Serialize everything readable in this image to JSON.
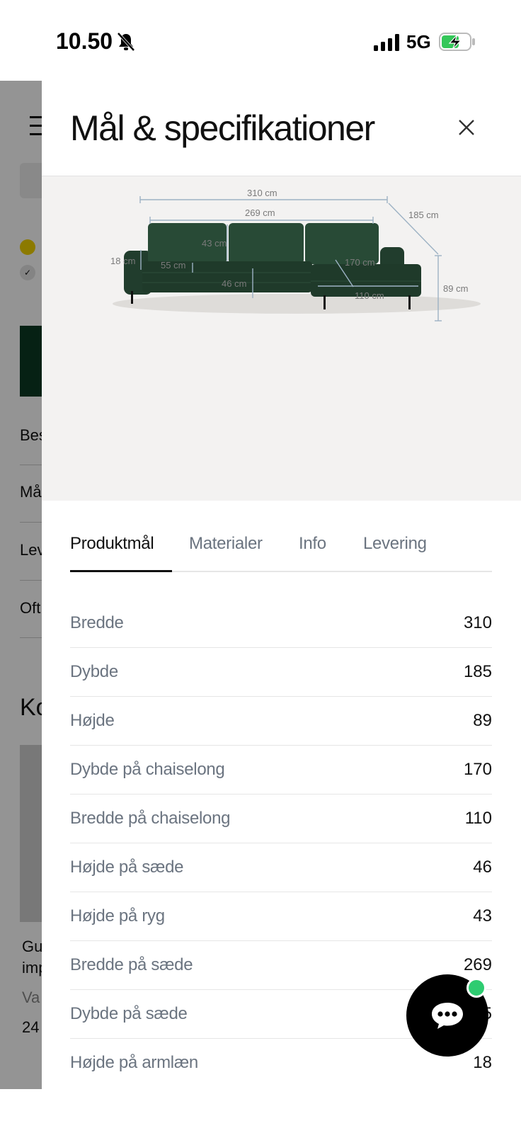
{
  "status_bar": {
    "time": "10.50",
    "network": "5G",
    "icons": [
      "bell-slash-icon",
      "signal-icon",
      "battery-charging-icon"
    ]
  },
  "background_page": {
    "row_labels": [
      "Bes",
      "Må",
      "Lev",
      "Oft"
    ],
    "section_heading": "Ko",
    "product_text_lines": [
      "Gu",
      "imp",
      "Va",
      "24"
    ]
  },
  "panel": {
    "title": "Mål & specifikationer",
    "close_icon": "close-icon",
    "figure": {
      "labels": {
        "width_total": "310 cm",
        "width_seat": "269 cm",
        "depth_total": "185 cm",
        "back_height": "43 cm",
        "arm_height": "18 cm",
        "seat_depth": "55 cm",
        "chaise_depth": "170 cm",
        "seat_height": "46 cm",
        "chaise_width": "110 cm",
        "height_total": "89 cm"
      },
      "sofa_color": "#1f3a2a",
      "dim_line_color": "#9db2c4"
    },
    "tabs": [
      {
        "label": "Produktmål",
        "active": true
      },
      {
        "label": "Materialer",
        "active": false
      },
      {
        "label": "Info",
        "active": false
      },
      {
        "label": "Levering",
        "active": false
      }
    ],
    "specs": [
      {
        "label": "Bredde",
        "value": "310"
      },
      {
        "label": "Dybde",
        "value": "185"
      },
      {
        "label": "Højde",
        "value": "89"
      },
      {
        "label": "Dybde på chaiselong",
        "value": "170"
      },
      {
        "label": "Bredde på chaiselong",
        "value": "110"
      },
      {
        "label": "Højde på sæde",
        "value": "46"
      },
      {
        "label": "Højde på ryg",
        "value": "43"
      },
      {
        "label": "Bredde på sæde",
        "value": "269"
      },
      {
        "label": "Dybde på sæde",
        "value": "55"
      },
      {
        "label": "Højde på armlæn",
        "value": "18"
      }
    ]
  },
  "chat": {
    "icon": "chat-bubble-icon",
    "online_color": "#2ecc71"
  }
}
